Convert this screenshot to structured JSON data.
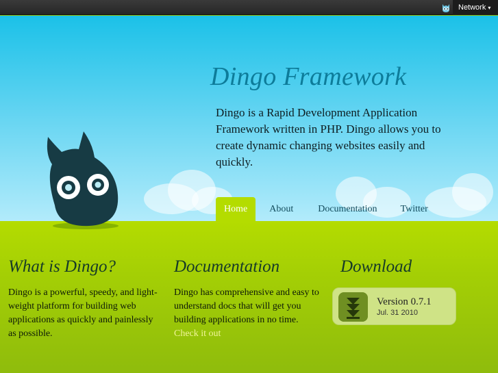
{
  "network": {
    "label": "Network",
    "caret": "▾",
    "mascot_icon": "dingo-mini-icon"
  },
  "header": {
    "title": "Dingo Framework",
    "intro": "Dingo is a Rapid Development Application Framework written in PHP. Dingo allows you to create dynamic changing websites easily and quickly."
  },
  "nav": {
    "items": [
      {
        "label": "Home",
        "active": true
      },
      {
        "label": "About"
      },
      {
        "label": "Documentation"
      },
      {
        "label": "Twitter"
      }
    ]
  },
  "columns": {
    "what": {
      "title": "What is Dingo?",
      "text": "Dingo is a powerful, speedy, and light-weight platform for building web applications as quickly and painlessly as possible."
    },
    "docs": {
      "title": "Documentation",
      "text": "Dingo has comprehensive and easy to understand docs that will get you building applications in no time.",
      "link": "Check it out"
    },
    "download": {
      "title": "Download",
      "version": "Version 0.7.1",
      "date": "Jul. 31 2010",
      "icon": "download-arrow-icon"
    }
  },
  "colors": {
    "sky_top": "#1bc1e8",
    "grass": "#b4dc00",
    "title": "#0d7c9a",
    "mascot": "#173b44",
    "link": "#f1f59a"
  }
}
